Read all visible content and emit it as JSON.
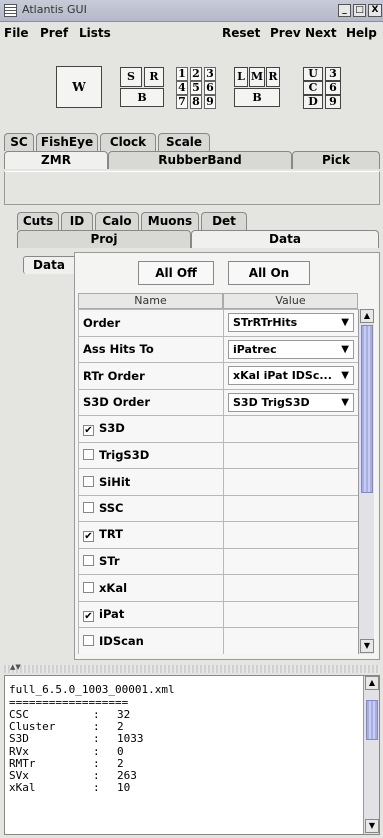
{
  "window": {
    "title": "Atlantis GUI",
    "min": "_",
    "max": "□",
    "close": "X"
  },
  "menu": {
    "file": "File",
    "pref": "Pref",
    "lists": "Lists",
    "reset": "Reset",
    "prev": "Prev",
    "next": "Next",
    "help": "Help"
  },
  "toolbar": {
    "w_label": "W",
    "s_label": "S",
    "r_label": "R",
    "b1_label": "B",
    "grid": [
      "1",
      "2",
      "3",
      "4",
      "5",
      "6",
      "7",
      "8",
      "9"
    ],
    "l_label": "L",
    "m_label": "M",
    "r2_label": "R",
    "b2_label": "B",
    "ucd": [
      "U",
      "C",
      "D"
    ],
    "nums": [
      "3",
      "6",
      "9"
    ]
  },
  "tabs_top_row1": [
    "SC",
    "FishEye",
    "Clock",
    "Scale"
  ],
  "tabs_top_row2": [
    "ZMR",
    "RubberBand",
    "Pick"
  ],
  "tabs_mid_row1": [
    "Cuts",
    "ID",
    "Calo",
    "Muons",
    "Det"
  ],
  "tabs_mid_row2": [
    "Proj",
    "Data"
  ],
  "side_tab": "Data",
  "buttons": {
    "all_off": "All Off",
    "all_on": "All On"
  },
  "table": {
    "headers": [
      "Name",
      "Value"
    ],
    "dropdown_rows": [
      {
        "name": "Order",
        "value": "STrRTrHits"
      },
      {
        "name": "Ass Hits To",
        "value": "iPatrec"
      },
      {
        "name": "RTr Order",
        "value": "xKal iPat IDSc..."
      },
      {
        "name": "S3D Order",
        "value": "S3D TrigS3D"
      }
    ],
    "checkbox_rows": [
      {
        "name": "S3D",
        "checked": true
      },
      {
        "name": "TrigS3D",
        "checked": false
      },
      {
        "name": "SiHit",
        "checked": false
      },
      {
        "name": "SSC",
        "checked": false
      },
      {
        "name": "TRT",
        "checked": true
      },
      {
        "name": "STr",
        "checked": false
      },
      {
        "name": "xKal",
        "checked": false
      },
      {
        "name": "iPat",
        "checked": true
      },
      {
        "name": "IDScan",
        "checked": false
      }
    ]
  },
  "log": {
    "filename": "full_6.5.0_1003_00001.xml",
    "separator": "==================",
    "rows": [
      {
        "key": "CSC",
        "value": "32"
      },
      {
        "key": "Cluster",
        "value": "2"
      },
      {
        "key": "S3D",
        "value": "1033"
      },
      {
        "key": "RVx",
        "value": "0"
      },
      {
        "key": "RMTr",
        "value": "2"
      },
      {
        "key": "SVx",
        "value": "263"
      },
      {
        "key": "xKal",
        "value": "10"
      }
    ]
  }
}
